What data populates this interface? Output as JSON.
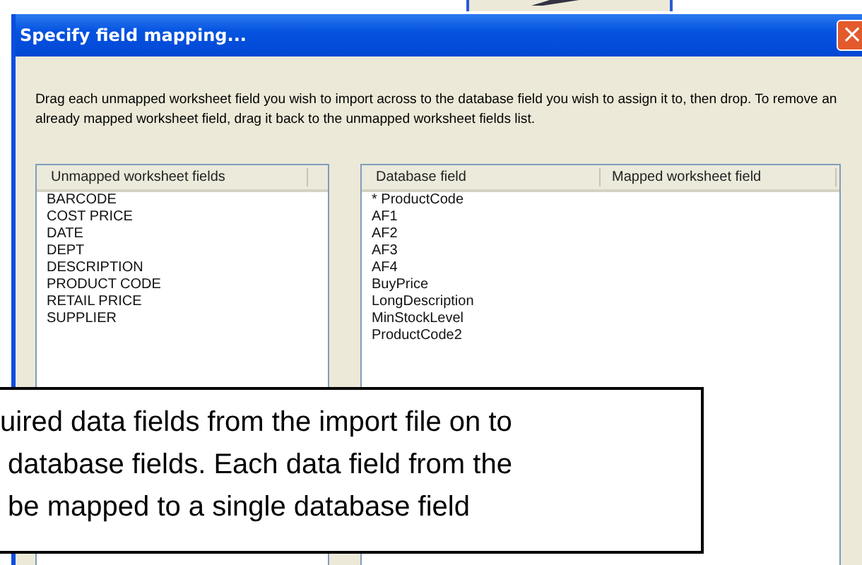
{
  "window": {
    "title": "Specify field mapping...",
    "close_icon": "×"
  },
  "instructions": "Drag each unmapped worksheet field you wish to import across to the database field you wish to assign it to, then drop.  To remove an already mapped worksheet field, drag it back to the unmapped worksheet fields list.",
  "unmapped_list": {
    "columns": [
      "Unmapped worksheet fields"
    ],
    "rows": [
      "BARCODE",
      "COST PRICE",
      "DATE",
      "DEPT",
      "DESCRIPTION",
      "PRODUCT CODE",
      "RETAIL PRICE",
      "SUPPLIER"
    ]
  },
  "mapping_list": {
    "columns": [
      "Database field",
      "Mapped worksheet field"
    ],
    "rows": [
      "* ProductCode",
      "AF1",
      "AF2",
      "AF3",
      "AF4",
      "BuyPrice",
      "LongDescription",
      "MinStockLevel",
      "ProductCode2"
    ]
  },
  "callout": {
    "lines": [
      "uired data fields from the import file on to",
      " database fields. Each data field from the",
      " be mapped to a single database field"
    ]
  }
}
